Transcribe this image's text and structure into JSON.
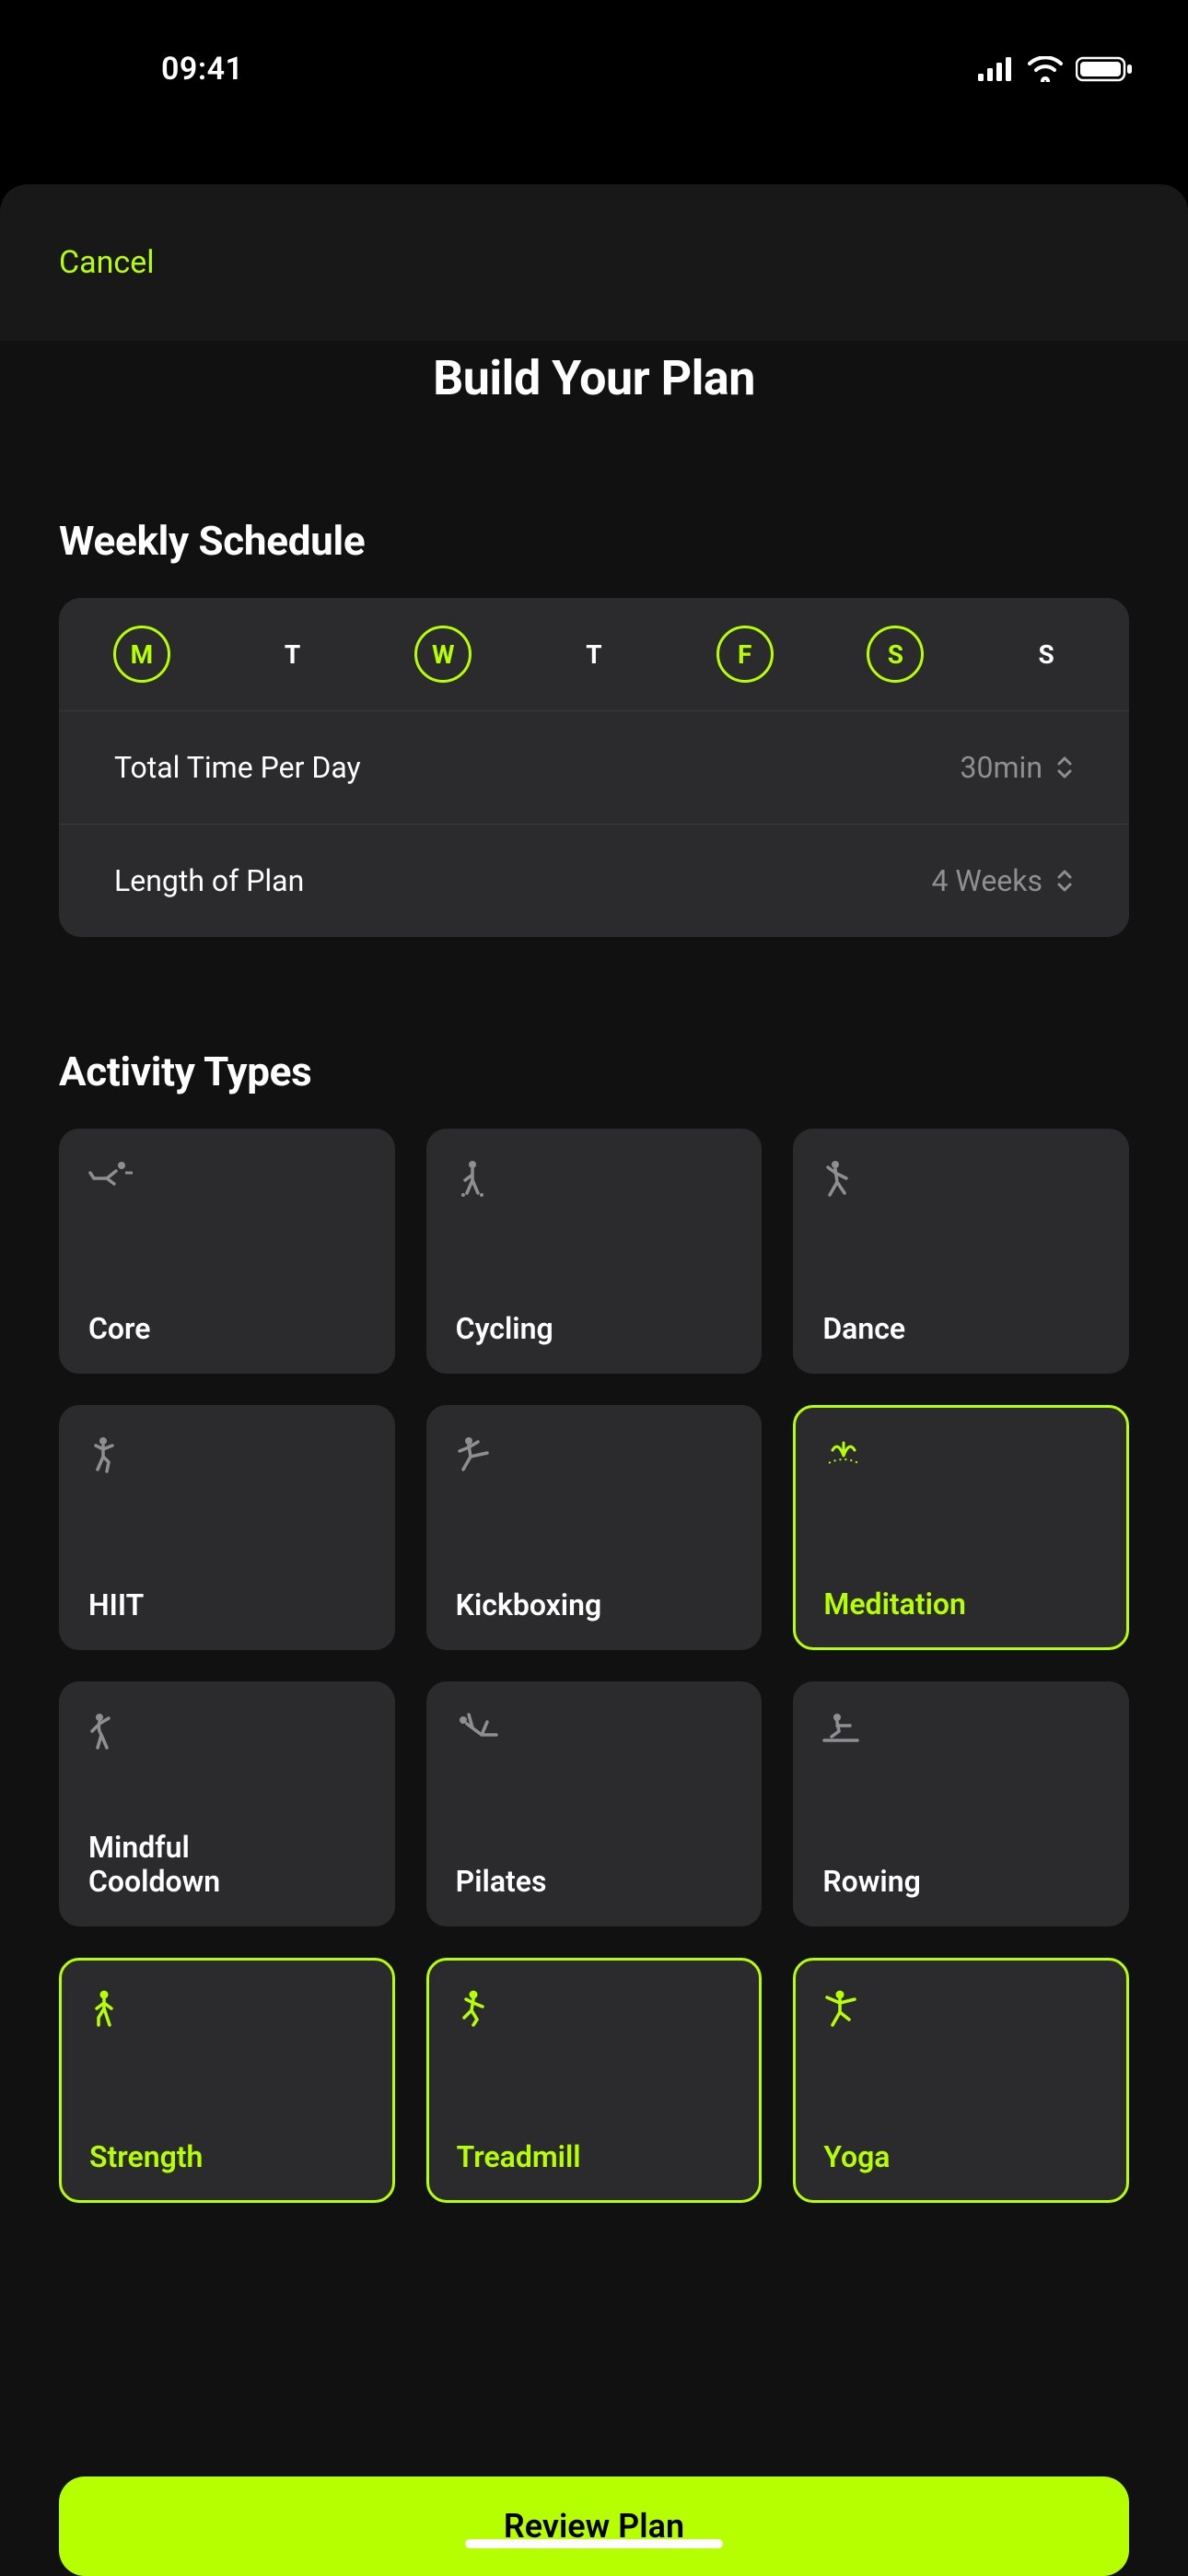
{
  "status": {
    "time": "09:41"
  },
  "nav": {
    "cancel": "Cancel"
  },
  "title": "Build Your Plan",
  "schedule": {
    "heading": "Weekly Schedule",
    "days": [
      {
        "letter": "M",
        "selected": true
      },
      {
        "letter": "T",
        "selected": false
      },
      {
        "letter": "W",
        "selected": true
      },
      {
        "letter": "T",
        "selected": false
      },
      {
        "letter": "F",
        "selected": true
      },
      {
        "letter": "S",
        "selected": true
      },
      {
        "letter": "S",
        "selected": false
      }
    ],
    "rows": {
      "time_label": "Total Time Per Day",
      "time_value": "30min",
      "length_label": "Length of Plan",
      "length_value": "4 Weeks"
    }
  },
  "activities": {
    "heading": "Activity Types",
    "items": [
      {
        "label": "Core",
        "icon": "core-icon",
        "selected": false
      },
      {
        "label": "Cycling",
        "icon": "cycling-icon",
        "selected": false
      },
      {
        "label": "Dance",
        "icon": "dance-icon",
        "selected": false
      },
      {
        "label": "HIIT",
        "icon": "hiit-icon",
        "selected": false
      },
      {
        "label": "Kickboxing",
        "icon": "kickboxing-icon",
        "selected": false
      },
      {
        "label": "Meditation",
        "icon": "meditation-icon",
        "selected": true
      },
      {
        "label": "Mindful\nCooldown",
        "icon": "cooldown-icon",
        "selected": false
      },
      {
        "label": "Pilates",
        "icon": "pilates-icon",
        "selected": false
      },
      {
        "label": "Rowing",
        "icon": "rowing-icon",
        "selected": false
      },
      {
        "label": "Strength",
        "icon": "strength-icon",
        "selected": true
      },
      {
        "label": "Treadmill",
        "icon": "treadmill-icon",
        "selected": true
      },
      {
        "label": "Yoga",
        "icon": "yoga-icon",
        "selected": true
      }
    ]
  },
  "cta": {
    "review": "Review Plan"
  },
  "colors": {
    "accent": "#b6ff00",
    "card": "#2b2b2d",
    "muted": "#8e8e93"
  }
}
